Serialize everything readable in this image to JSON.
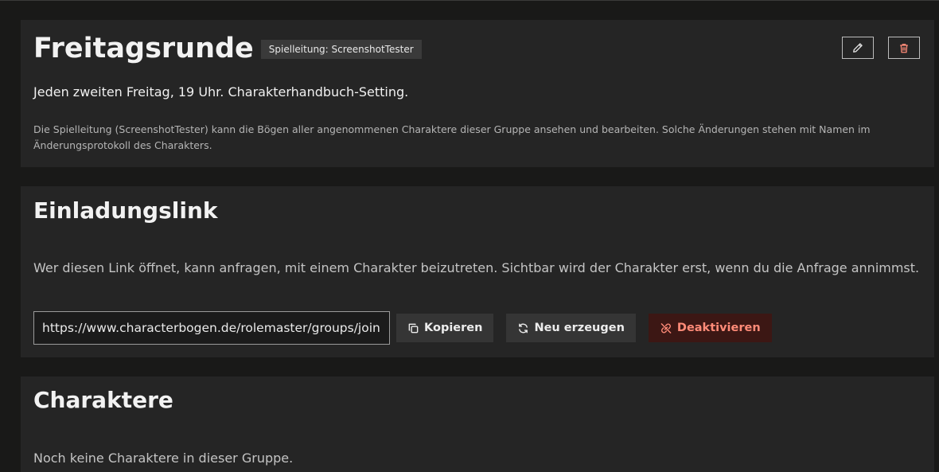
{
  "group": {
    "title": "Freitagsrunde",
    "gm_badge": "Spielleitung: ScreenshotTester",
    "description": "Jeden zweiten Freitag, 19 Uhr. Charakterhandbuch-Setting.",
    "note": "Die Spielleitung (ScreenshotTester) kann die Bögen aller angenommenen Charaktere dieser Gruppe ansehen und bearbeiten. Solche Änderungen stehen mit Namen im Änderungsprotokoll des Charakters.",
    "edit_icon": "pencil-icon",
    "delete_icon": "trash-icon"
  },
  "invite": {
    "title": "Einladungslink",
    "description": "Wer diesen Link öffnet, kann anfragen, mit einem Charakter beizutreten. Sichtbar wird der Charakter erst, wenn du die Anfrage annimmst.",
    "link_value": "https://www.characterbogen.de/rolemaster/groups/join",
    "copy_label": "Kopieren",
    "regenerate_label": "Neu erzeugen",
    "deactivate_label": "Deaktivieren",
    "copy_icon": "copy-icon",
    "regenerate_icon": "refresh-icon",
    "deactivate_icon": "link-off-icon"
  },
  "characters": {
    "title": "Charaktere",
    "empty_text": "Noch keine Charaktere in dieser Gruppe."
  },
  "colors": {
    "page_bg": "#191918",
    "card_bg": "#252525",
    "badge_bg": "#3a3a3a",
    "danger_bg": "#3c1714",
    "danger_text": "#ff8b78"
  }
}
